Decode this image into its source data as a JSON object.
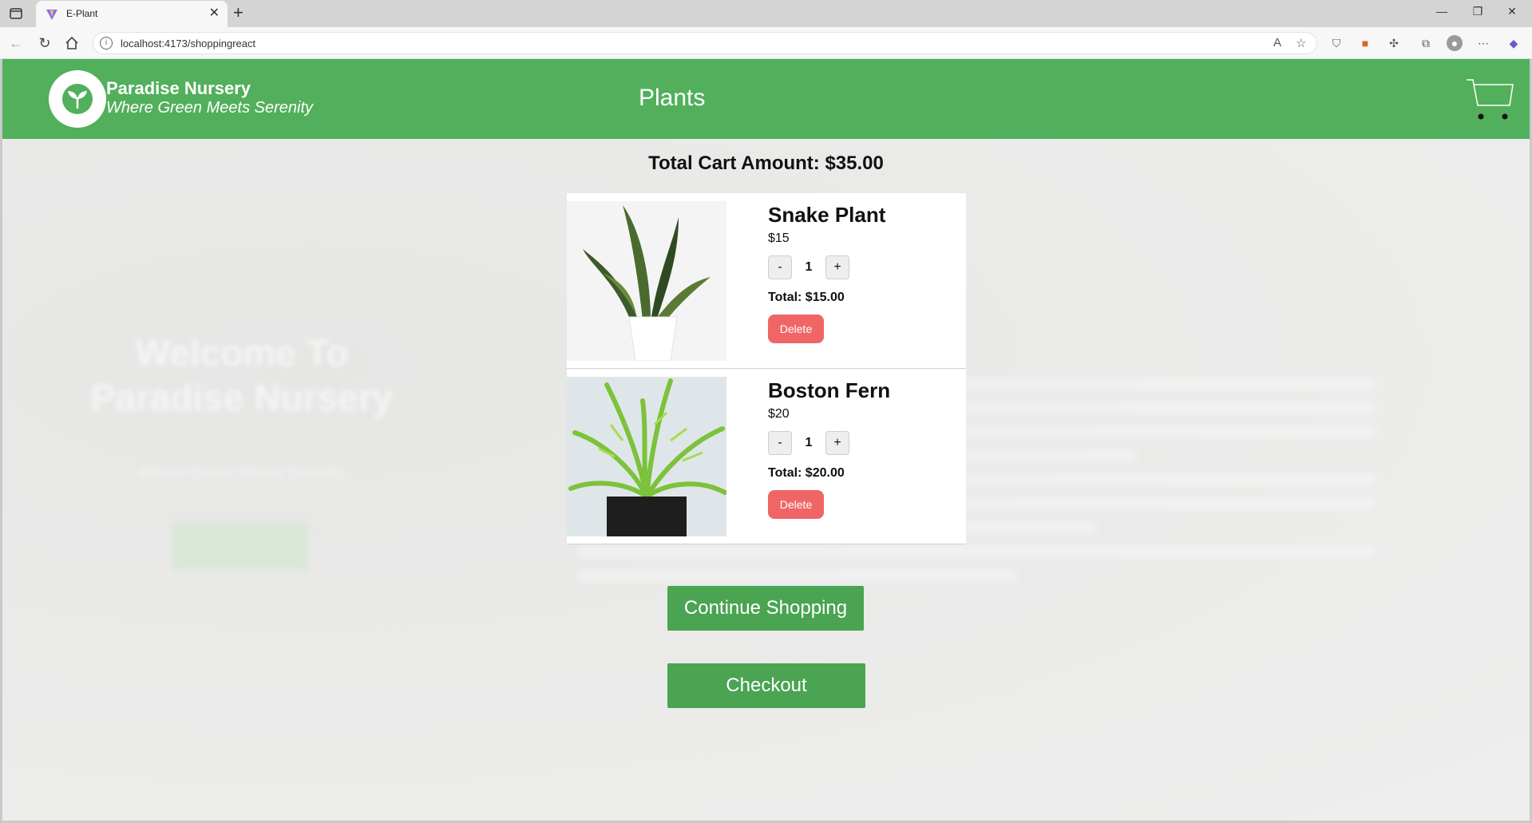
{
  "browser": {
    "tab_title": "E-Plant",
    "tab_close": "✕",
    "new_tab": "+",
    "url": "localhost:4173/shoppingreact",
    "window_controls": {
      "minimize": "—",
      "restore": "❐",
      "close": "✕"
    }
  },
  "header": {
    "brand_name": "Paradise Nursery",
    "brand_tagline": "Where Green Meets Serenity",
    "nav_link": "Plants",
    "accent_color": "#52af5c"
  },
  "background": {
    "hero_title": "Welcome To Paradise Nursery",
    "hero_subtitle": "Where Green Meets Serenity"
  },
  "cart": {
    "total_label": "Total Cart Amount: $35.00",
    "items": [
      {
        "name": "Snake Plant",
        "price": "$15",
        "quantity": "1",
        "minus": "-",
        "plus": "+",
        "total": "Total: $15.00",
        "delete_label": "Delete"
      },
      {
        "name": "Boston Fern",
        "price": "$20",
        "quantity": "1",
        "minus": "-",
        "plus": "+",
        "total": "Total: $20.00",
        "delete_label": "Delete"
      }
    ],
    "continue_label": "Continue Shopping",
    "checkout_label": "Checkout",
    "button_color": "#4aa452",
    "delete_color": "#f06666"
  }
}
